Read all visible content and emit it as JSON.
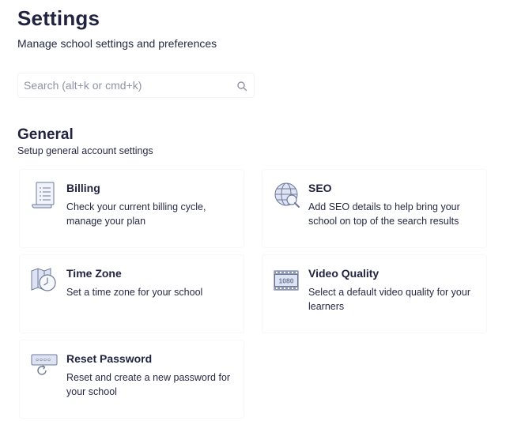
{
  "header": {
    "title": "Settings",
    "subtitle": "Manage school settings and preferences"
  },
  "search": {
    "placeholder": "Search (alt+k or cmd+k)",
    "value": "",
    "icon": "search-icon"
  },
  "general": {
    "title": "General",
    "subtitle": "Setup general account settings",
    "cards": [
      {
        "title": "Billing",
        "description": "Check your current billing cycle, manage your plan",
        "icon": "billing-icon"
      },
      {
        "title": "SEO",
        "description": "Add SEO details to help bring your school on top of the search results",
        "icon": "globe-icon"
      },
      {
        "title": "Time Zone",
        "description": "Set a time zone for your school",
        "icon": "time-zone-icon"
      },
      {
        "title": "Video Quality",
        "description": "Select a default video quality for your learners",
        "icon": "video-quality-icon",
        "icon_text": "1080"
      },
      {
        "title": "Reset Password",
        "description": "Reset and create a new password for your school",
        "icon": "reset-password-icon"
      }
    ]
  },
  "colors": {
    "text": "#1f2340",
    "icon_fill": "#dde3f3",
    "icon_stroke": "#6d7a98"
  }
}
